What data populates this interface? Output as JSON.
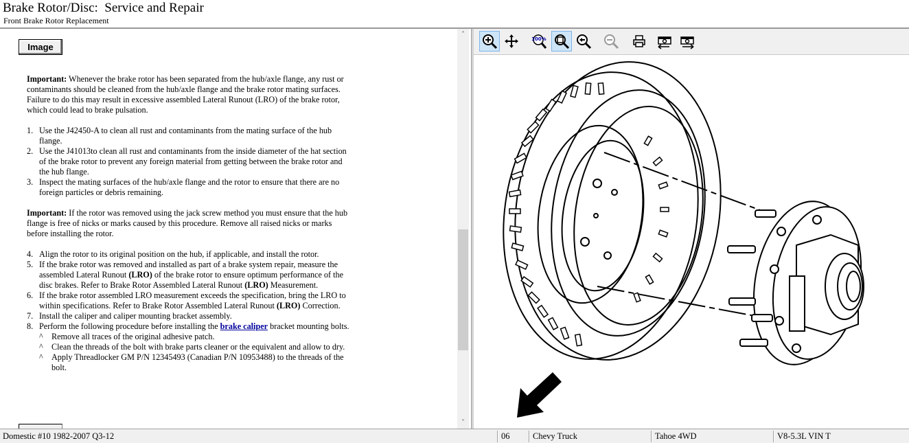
{
  "header": {
    "title": "Brake Rotor/Disc:  Service and Repair",
    "subtitle": "Front Brake Rotor Replacement"
  },
  "left": {
    "image_button": "Image",
    "important1": {
      "label": "Important:",
      "text": " Whenever the brake rotor has been separated from the hub/axle flange, any rust or contaminants should be cleaned from the hub/axle flange and the brake rotor mating surfaces. Failure to do this may result in excessive assembled Lateral Runout (LRO) of the brake rotor, which could lead to brake pulsation."
    },
    "steps_a": [
      {
        "num": "1.",
        "text": "Use the J42450-A to clean all rust and contaminants from the mating surface of the hub flange."
      },
      {
        "num": "2.",
        "text": "Use the J41013to clean all rust and contaminants from the inside diameter of the hat section of the brake rotor to prevent any foreign material from getting between the brake rotor and the hub flange."
      },
      {
        "num": "3.",
        "text": "Inspect the mating surfaces of the hub/axle flange and the rotor to ensure that there are no foreign particles or debris remaining."
      }
    ],
    "important2": {
      "label": "Important:",
      "text": " If the rotor was removed using the jack screw method you must ensure that the hub flange is free of nicks or marks caused by this procedure. Remove all raised nicks or marks before installing the rotor."
    },
    "step4": {
      "num": "4.",
      "text": "Align the rotor to its original position on the hub, if applicable, and install the rotor."
    },
    "step5": {
      "num": "5.",
      "t1": "If the brake rotor was removed and installed as part of a brake system repair, measure the assembled Lateral Runout ",
      "b1": "(LRO)",
      "t2": " of the brake rotor to ensure optimum performance of the disc brakes. Refer to Brake Rotor Assembled Lateral Runout ",
      "b2": "(LRO)",
      "t3": " Measurement."
    },
    "step6": {
      "num": "6.",
      "t1": "If the brake rotor assembled LRO measurement exceeds the specification, bring the LRO to within specifications. Refer to Brake Rotor Assembled Lateral Runout ",
      "b1": "(LRO)",
      "t2": " Correction."
    },
    "step7": {
      "num": "7.",
      "text": "Install the caliper and caliper mounting bracket assembly."
    },
    "step8": {
      "num": "8.",
      "t1": "Perform the following procedure before installing the ",
      "link": "brake caliper",
      "t2": " bracket mounting bolts."
    },
    "substeps": [
      {
        "caret": "^",
        "text": "Remove all traces of the original adhesive patch."
      },
      {
        "caret": "^",
        "text": "Clean the threads of the bolt with brake parts cleaner or the equivalent and allow to dry."
      },
      {
        "caret": "^",
        "text": "Apply Threadlocker GM P/N 12345493 (Canadian P/N 10953488) to the threads of the bolt."
      }
    ]
  },
  "scrollbar": {
    "up": "˄",
    "down": "˅"
  },
  "toolbar": {
    "buttons": [
      "zoom-in-icon",
      "pan-icon",
      "zoom-100-icon",
      "zoom-fit-icon",
      "zoom-region-icon",
      "zoom-out-icon",
      "print-icon",
      "prev-image-icon",
      "next-image-icon"
    ],
    "zoom_100_text": "100%"
  },
  "status": {
    "database": "Domestic #10 1982-2007 Q3-12",
    "year": "06",
    "make": "Chevy Truck",
    "model": "Tahoe 4WD",
    "engine": "V8-5.3L VIN T"
  }
}
